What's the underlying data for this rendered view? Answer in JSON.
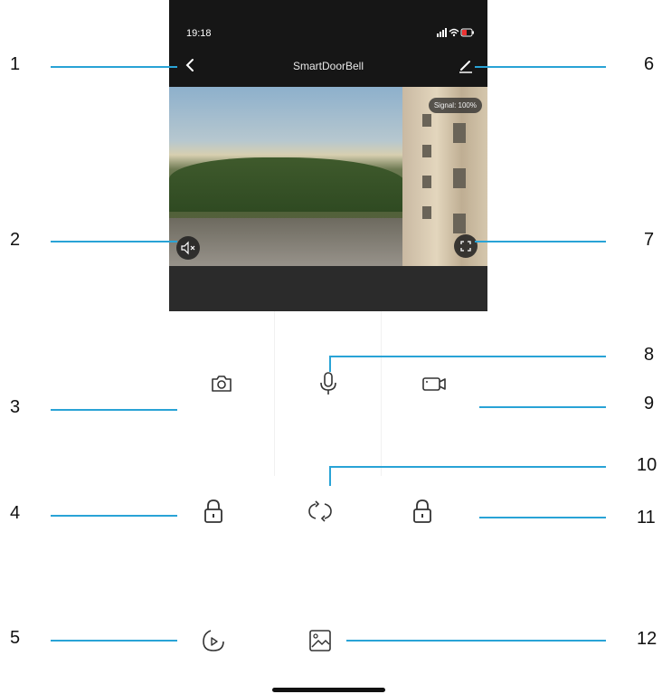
{
  "status_bar": {
    "time": "19:18",
    "icons": "signal wifi battery-charging"
  },
  "nav": {
    "title": "SmartDoorBell",
    "back_icon": "chevron-left-icon",
    "edit_icon": "pencil-icon"
  },
  "video": {
    "signal_text": "Signal: 100%",
    "mute_icon": "speaker-muted-icon",
    "fullscreen_icon": "fullscreen-icon"
  },
  "controls": [
    {
      "icon": "camera-icon"
    },
    {
      "icon": "microphone-icon"
    },
    {
      "icon": "video-record-icon"
    },
    {
      "icon": "unlock-icon"
    },
    {
      "icon": "refresh-icon"
    },
    {
      "icon": "unlock-icon"
    },
    {
      "icon": "playback-icon"
    },
    {
      "icon": "gallery-icon"
    }
  ],
  "callouts": [
    "1",
    "2",
    "3",
    "4",
    "5",
    "6",
    "7",
    "8",
    "9",
    "10",
    "11",
    "12"
  ],
  "colors": {
    "callout_line": "#29a3d6",
    "header_bg": "#161616",
    "icon": "#333333"
  }
}
